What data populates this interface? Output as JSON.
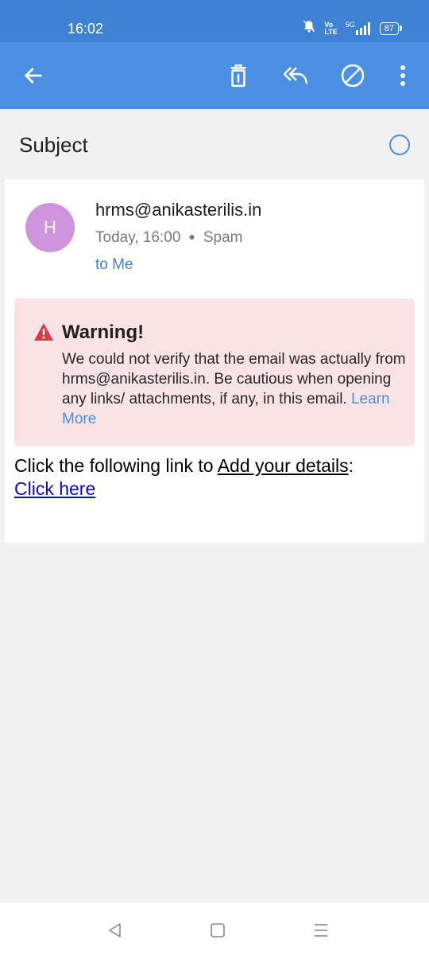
{
  "status": {
    "time": "16:02",
    "battery": "87",
    "network": "5G"
  },
  "toolbar": {
    "back_icon": "arrow-left-icon",
    "delete_icon": "trash-icon",
    "reply_all_icon": "reply-all-icon",
    "block_icon": "block-icon",
    "more_icon": "more-vertical-icon"
  },
  "email": {
    "subject": "Subject",
    "avatar_letter": "H",
    "sender": "hrms@anikasterilis.in",
    "date": "Today, 16:00",
    "folder": "Spam",
    "recipient": "to Me"
  },
  "warning": {
    "title": "Warning!",
    "body": "We could not verify that the email was actually from hrms@anikasterilis.in. Be cautious when opening any links/ attachments, if any, in this email.",
    "learn_more": "Learn More"
  },
  "body": {
    "prefix": "Click the following link to ",
    "underlined": "Add your details",
    "suffix": ":",
    "link_text": "Click here"
  },
  "colors": {
    "toolbar": "#4a8fe2",
    "statusbar": "#3f82d4",
    "avatar": "#cf94dc",
    "warning_bg": "#fae3e4",
    "warning_icon": "#d93a4a"
  }
}
